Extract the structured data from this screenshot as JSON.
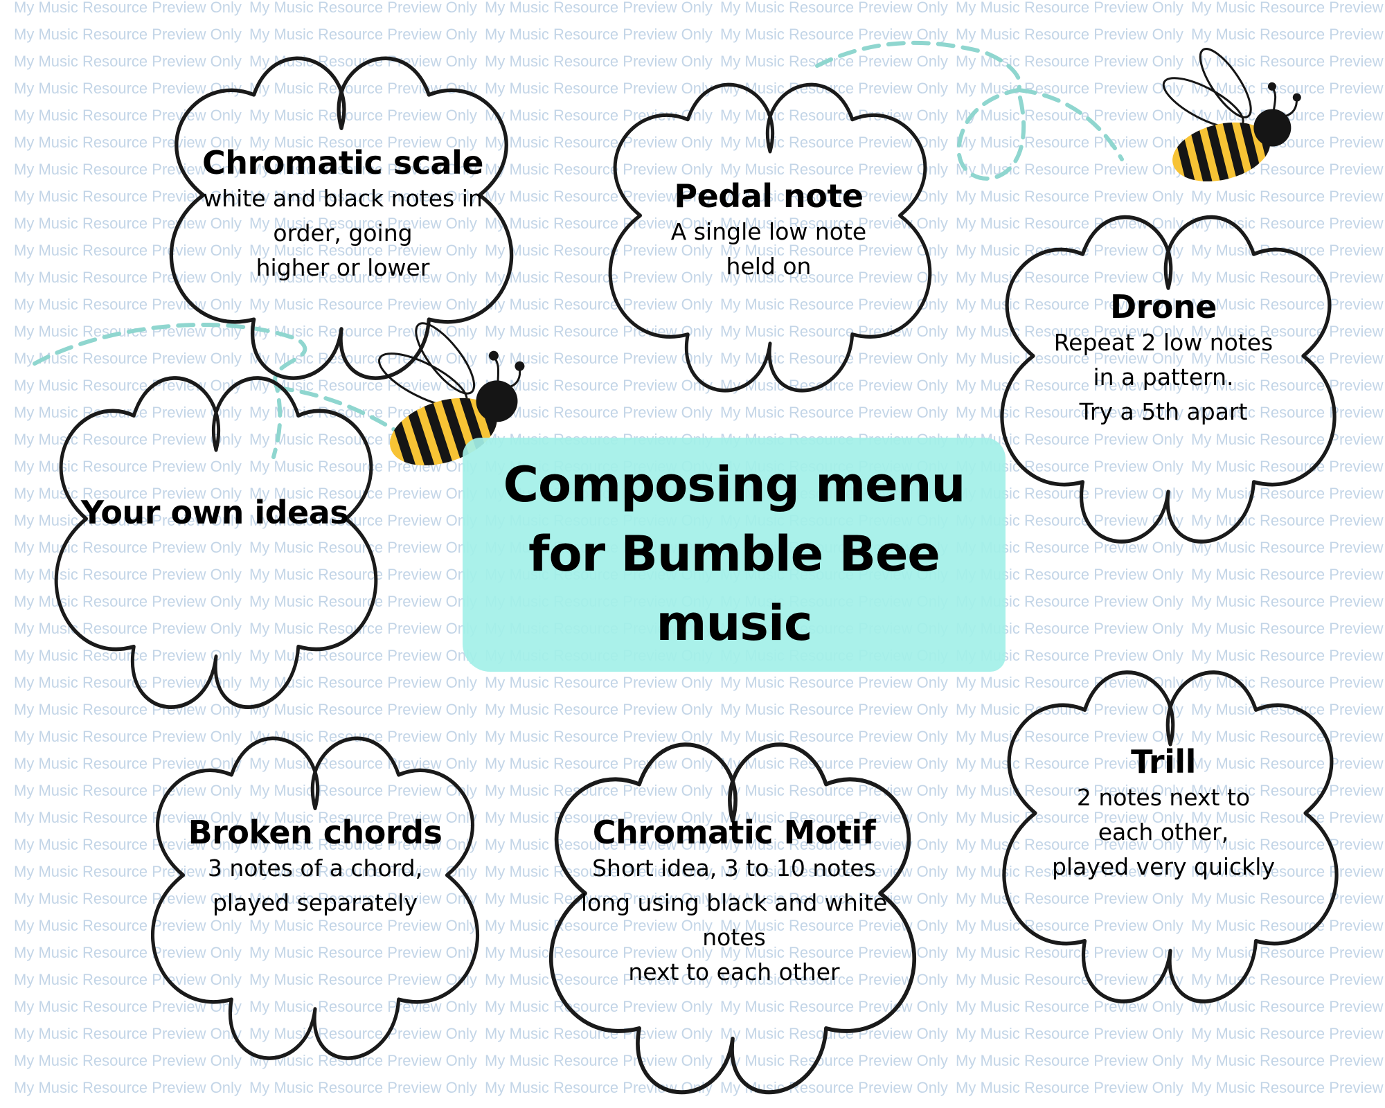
{
  "watermark": {
    "text": "My Music Resource Preview Only"
  },
  "heading": {
    "title": "Composing menu\nfor  Bumble Bee\nmusic"
  },
  "colors": {
    "highlight": "#a3f0e8",
    "flight_path": "#8fd6cf",
    "bee_yellow": "#f7c335",
    "bee_black": "#151515",
    "outline": "#1a1a1a",
    "watermark": "#c3d5e7"
  },
  "cards": [
    {
      "id": "chromatic-scale",
      "title": "Chromatic scale",
      "desc": "white and black notes in\norder, going\nhigher or lower"
    },
    {
      "id": "pedal-note",
      "title": "Pedal note",
      "desc": "A single low note\nheld on"
    },
    {
      "id": "drone",
      "title": "Drone",
      "desc": "Repeat 2 low notes\nin a pattern.\nTry a 5th apart"
    },
    {
      "id": "your-own-ideas",
      "title": "Your own ideas",
      "desc": ""
    },
    {
      "id": "broken-chords",
      "title": "Broken chords",
      "desc": "3 notes of a chord,\nplayed separately"
    },
    {
      "id": "chromatic-motif",
      "title": "Chromatic Motif",
      "desc": "Short idea, 3 to 10 notes\nlong using black and white\nnotes\nnext to each other"
    },
    {
      "id": "trill",
      "title": "Trill",
      "desc": "2 notes next to\neach other,\nplayed very quickly"
    }
  ],
  "decorations": [
    "bee-icon",
    "bee-icon",
    "flight-path",
    "flight-path"
  ]
}
